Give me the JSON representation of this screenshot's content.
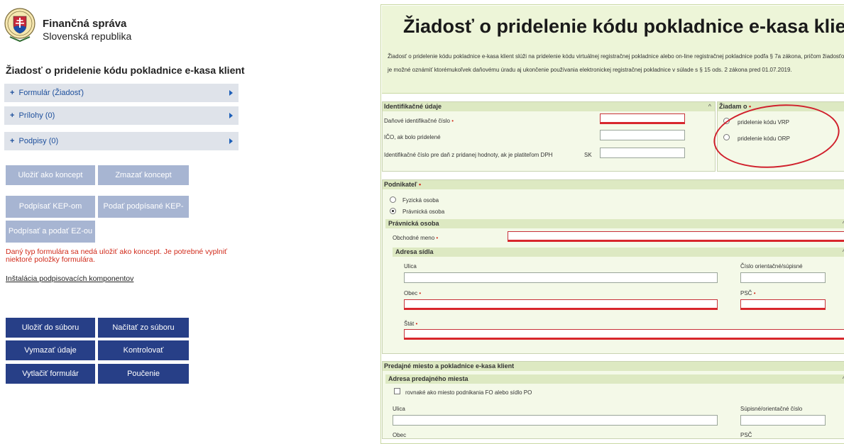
{
  "brand": {
    "title": "Finančná správa",
    "subtitle": "Slovenská republika"
  },
  "sidebar": {
    "form_title": "Žiadosť o pridelenie kódu pokladnice e-kasa klient",
    "accordion": [
      {
        "label": "Formulár (Žiadosť)"
      },
      {
        "label": "Prílohy (0)"
      },
      {
        "label": "Podpisy (0)"
      }
    ],
    "buttons": {
      "save_draft": "Uložiť ako koncept",
      "delete_draft": "Zmazať koncept",
      "sign_kep": "Podpísať KEP-om",
      "submit_signed_kep": "Podať podpísané KEP-om",
      "sign_submit_ez": "Podpísať a podať EZ-ou",
      "save_file": "Uložiť do súboru",
      "load_file": "Načítať zo súboru",
      "clear": "Vymazať údaje",
      "check": "Kontrolovať",
      "print": "Vytlačiť formulár",
      "help": "Poučenie"
    },
    "warning": "Daný typ formulára sa nedá uložiť ako koncept. Je potrebné vyplniť niektoré položky formulára.",
    "install_link": "Inštalácia podpisovacích komponentov"
  },
  "form": {
    "title": "Žiadosť o pridelenie kódu pokladnice e-kasa klient",
    "description": "Žiadosť o pridelenie kódu pokladnice e-kasa klient slúži na pridelenie kódu virtuálnej registračnej pokladnice alebo on-line registračnej pokladnice podľa § 7a zákona, pričom žiadosťou je možné oznámiť ktorémukoľvek daňovému úradu aj ukončenie používania elektronickej registračnej pokladnice v súlade s § 15 ods. 2 zákona pred 01.07.2019.",
    "id_section": {
      "title": "Identifikačné údaje",
      "dic_label": "Daňové identifikačné číslo",
      "ico_label": "IČO, ak bolo pridelené",
      "icdph_label": "Identifikačné číslo pre daň z pridanej hodnoty, ak je platiteľom DPH",
      "icdph_prefix": "SK"
    },
    "request_section": {
      "title": "Žiadam o",
      "opt_vrp": "pridelenie kódu VRP",
      "opt_orp": "pridelenie kódu ORP"
    },
    "entrepreneur": {
      "title": "Podnikateľ",
      "opt_fo": "Fyzická osoba",
      "opt_po": "Právnická osoba",
      "po_title": "Právnická osoba",
      "business_name": "Obchodné meno",
      "address_title": "Adresa sídla",
      "street": "Ulica",
      "number": "Číslo orientačné/súpisné",
      "city": "Obec",
      "zip": "PSČ",
      "country": "Štát"
    },
    "shop": {
      "title": "Predajné miesto a pokladnice e-kasa klient",
      "address_title": "Adresa predajného miesta",
      "same_as": "rovnaké ako miesto podnikania FO alebo sídlo PO",
      "street": "Ulica",
      "number": "Súpisné/orientačné číslo",
      "city": "Obec",
      "zip": "PSČ"
    },
    "required_mark": "•"
  }
}
